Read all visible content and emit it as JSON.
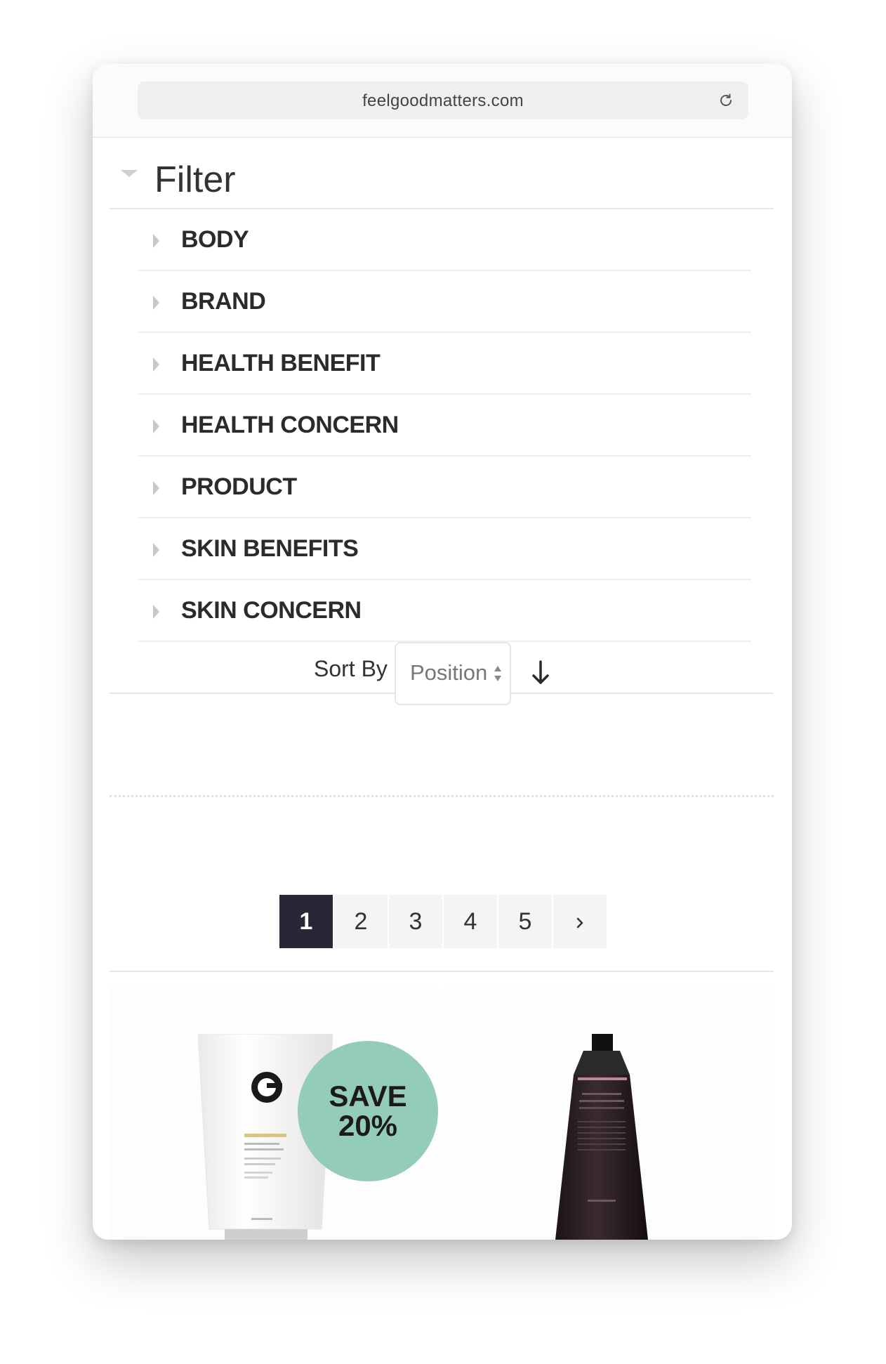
{
  "browser": {
    "url": "feelgoodmatters.com",
    "reload_icon": "reload-icon"
  },
  "filter": {
    "title": "Filter",
    "facets": [
      {
        "label": "BODY"
      },
      {
        "label": "BRAND"
      },
      {
        "label": "HEALTH BENEFIT"
      },
      {
        "label": "HEALTH CONCERN"
      },
      {
        "label": "PRODUCT"
      },
      {
        "label": "SKIN BENEFITS"
      },
      {
        "label": "SKIN CONCERN"
      }
    ]
  },
  "sort": {
    "label": "Sort By",
    "selected": "Position",
    "direction_icon": "arrow-down-icon"
  },
  "pagination": {
    "pages": [
      "1",
      "2",
      "3",
      "4",
      "5"
    ],
    "current": "1",
    "next_icon": "chevron-right-icon"
  },
  "products": [
    {
      "badge_line1": "SAVE",
      "badge_line2": "20%",
      "badge_color": "#94cdb7"
    },
    {}
  ],
  "colors": {
    "pager_active": "#2b2637",
    "badge": "#94cdb7"
  }
}
